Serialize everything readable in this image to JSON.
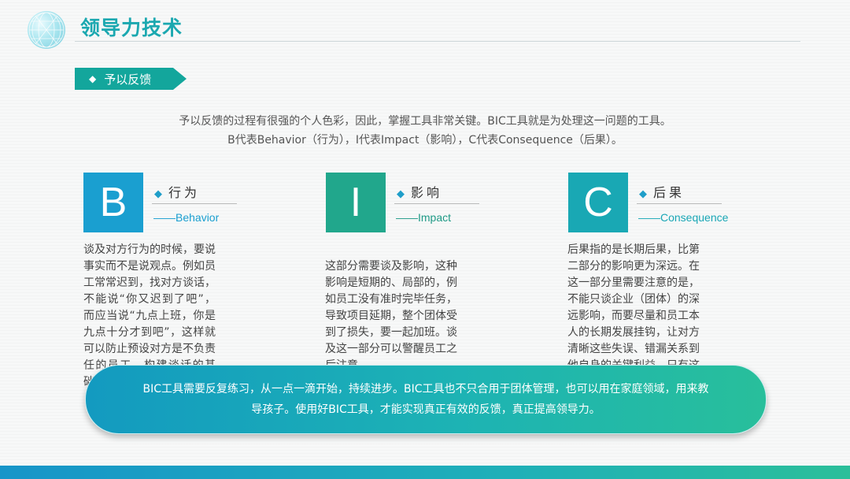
{
  "header": {
    "title": "领导力技术"
  },
  "section": {
    "label": "予以反馈",
    "marker": "◆"
  },
  "intro": {
    "line1": "予以反馈的过程有很强的个人色彩，因此，掌握工具非常关键。BIC工具就是为处理这一问题的工具。",
    "line2": "B代表Behavior（行为），I代表Impact（影响），C代表Consequence（后果）。"
  },
  "cards": [
    {
      "letter": "B",
      "marker": "◆",
      "heading": "行为",
      "subheading": "——Behavior",
      "color": "#1a9fd0",
      "sub_color": "#1a9fd0",
      "body": "谈及对方行为的时候，要说事实而不是说观点。例如员工常常迟到，找对方谈话，不能说“你又迟到了吧”，而应当说“九点上班，你是九点十分才到吧”，这样就可以防止预设对方是不负责任的员工，构建谈话的基础，让对方更轻易听进去。"
    },
    {
      "letter": "I",
      "marker": "◆",
      "heading": "影响",
      "subheading": "——Impact",
      "color": "#21a78c",
      "sub_color": "#1f9a86",
      "body": "这部分需要谈及影响，这种影响是短期的、局部的，例如员工没有准时完毕任务，导致项目延期，整个团体受到了损失，要一起加班。谈及这一部分可以警醒员工之后注意。"
    },
    {
      "letter": "C",
      "marker": "◆",
      "heading": "后果",
      "subheading": "——Consequence",
      "color": "#19a8b4",
      "sub_color": "#1aa7b6",
      "body": "后果指的是长期后果，比第二部分的影响更为深远。在这一部分里需要注意的是，不能只谈企业（团体）的深远影响，而要尽量和员工本人的长期发展挂钩，让对方清晰这些失误、错漏关系到他自身的关键利益。只有这样才能真正引起对方的重视。"
    }
  ],
  "banner": {
    "text": "BIC工具需要反复练习，从一点一滴开始，持续进步。BIC工具也不只合用于团体管理，也可以用在家庭领域，用来教导孩子。使用好BIC工具，才能实现真正有效的反馈，真正提高领导力。"
  },
  "icons": {
    "logo": "globe-icon",
    "bullet": "diamond-icon"
  }
}
